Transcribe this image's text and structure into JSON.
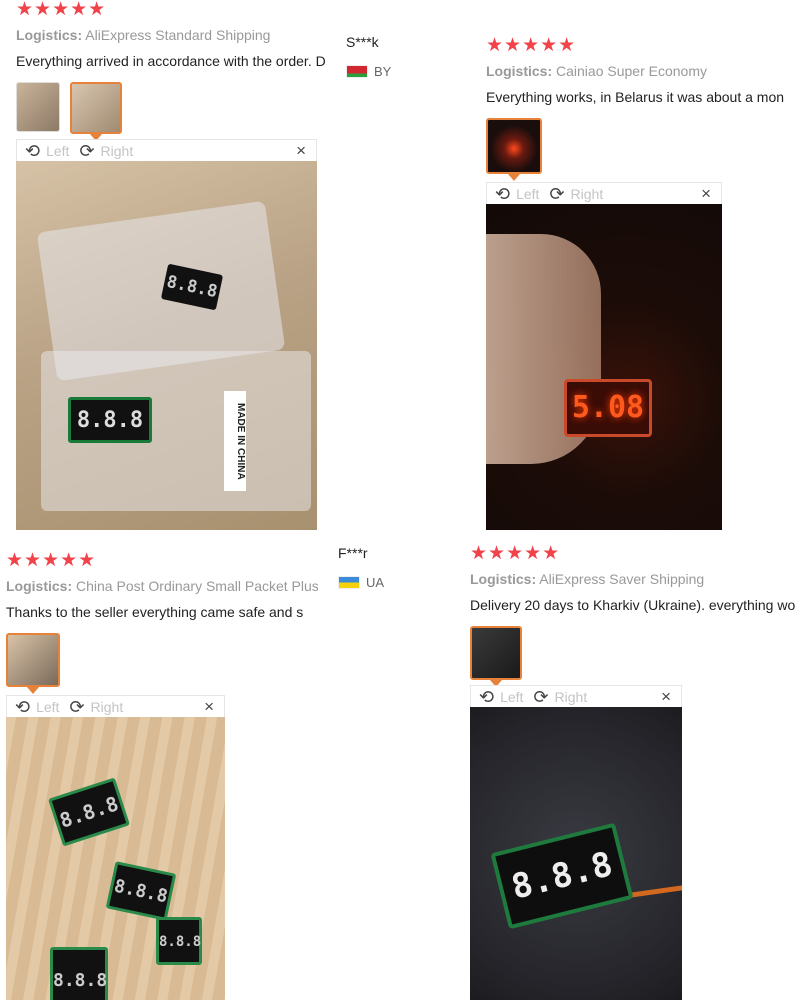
{
  "reviews": [
    {
      "stars": "★★★★★",
      "logistics_label": "Logistics:",
      "logistics_value": "AliExpress Standard Shipping",
      "text": "Everything arrived in accordance with the order. D",
      "viewer": {
        "left": "Left",
        "right": "Right",
        "close": "×"
      }
    },
    {
      "stars": "★★★★★",
      "logistics_label": "Logistics:",
      "logistics_value": "Cainiao Super Economy",
      "text": "Everything works, in Belarus it was about a mon",
      "viewer": {
        "left": "Left",
        "right": "Right",
        "close": "×"
      },
      "display_reading": "5.08"
    },
    {
      "stars": "★★★★★",
      "logistics_label": "Logistics:",
      "logistics_value": "China Post Ordinary Small Packet Plus",
      "text": "Thanks to the seller everything came safe and s",
      "viewer": {
        "left": "Left",
        "right": "Right",
        "close": "×"
      }
    },
    {
      "stars": "★★★★★",
      "logistics_label": "Logistics:",
      "logistics_value": "AliExpress Saver Shipping",
      "text": "Delivery 20 days to Kharkiv (Ukraine). everything wo",
      "viewer": {
        "left": "Left",
        "right": "Right",
        "close": "×"
      }
    }
  ],
  "users": [
    {
      "name": "S***k",
      "country": "BY"
    },
    {
      "name": "F***r",
      "country": "UA"
    }
  ],
  "display_placeholder": "8.8.8",
  "package_label": "MADE IN CHINA",
  "icons": {
    "rotate_left": "rotate-left-icon",
    "rotate_right": "rotate-right-icon",
    "close": "close-icon"
  }
}
